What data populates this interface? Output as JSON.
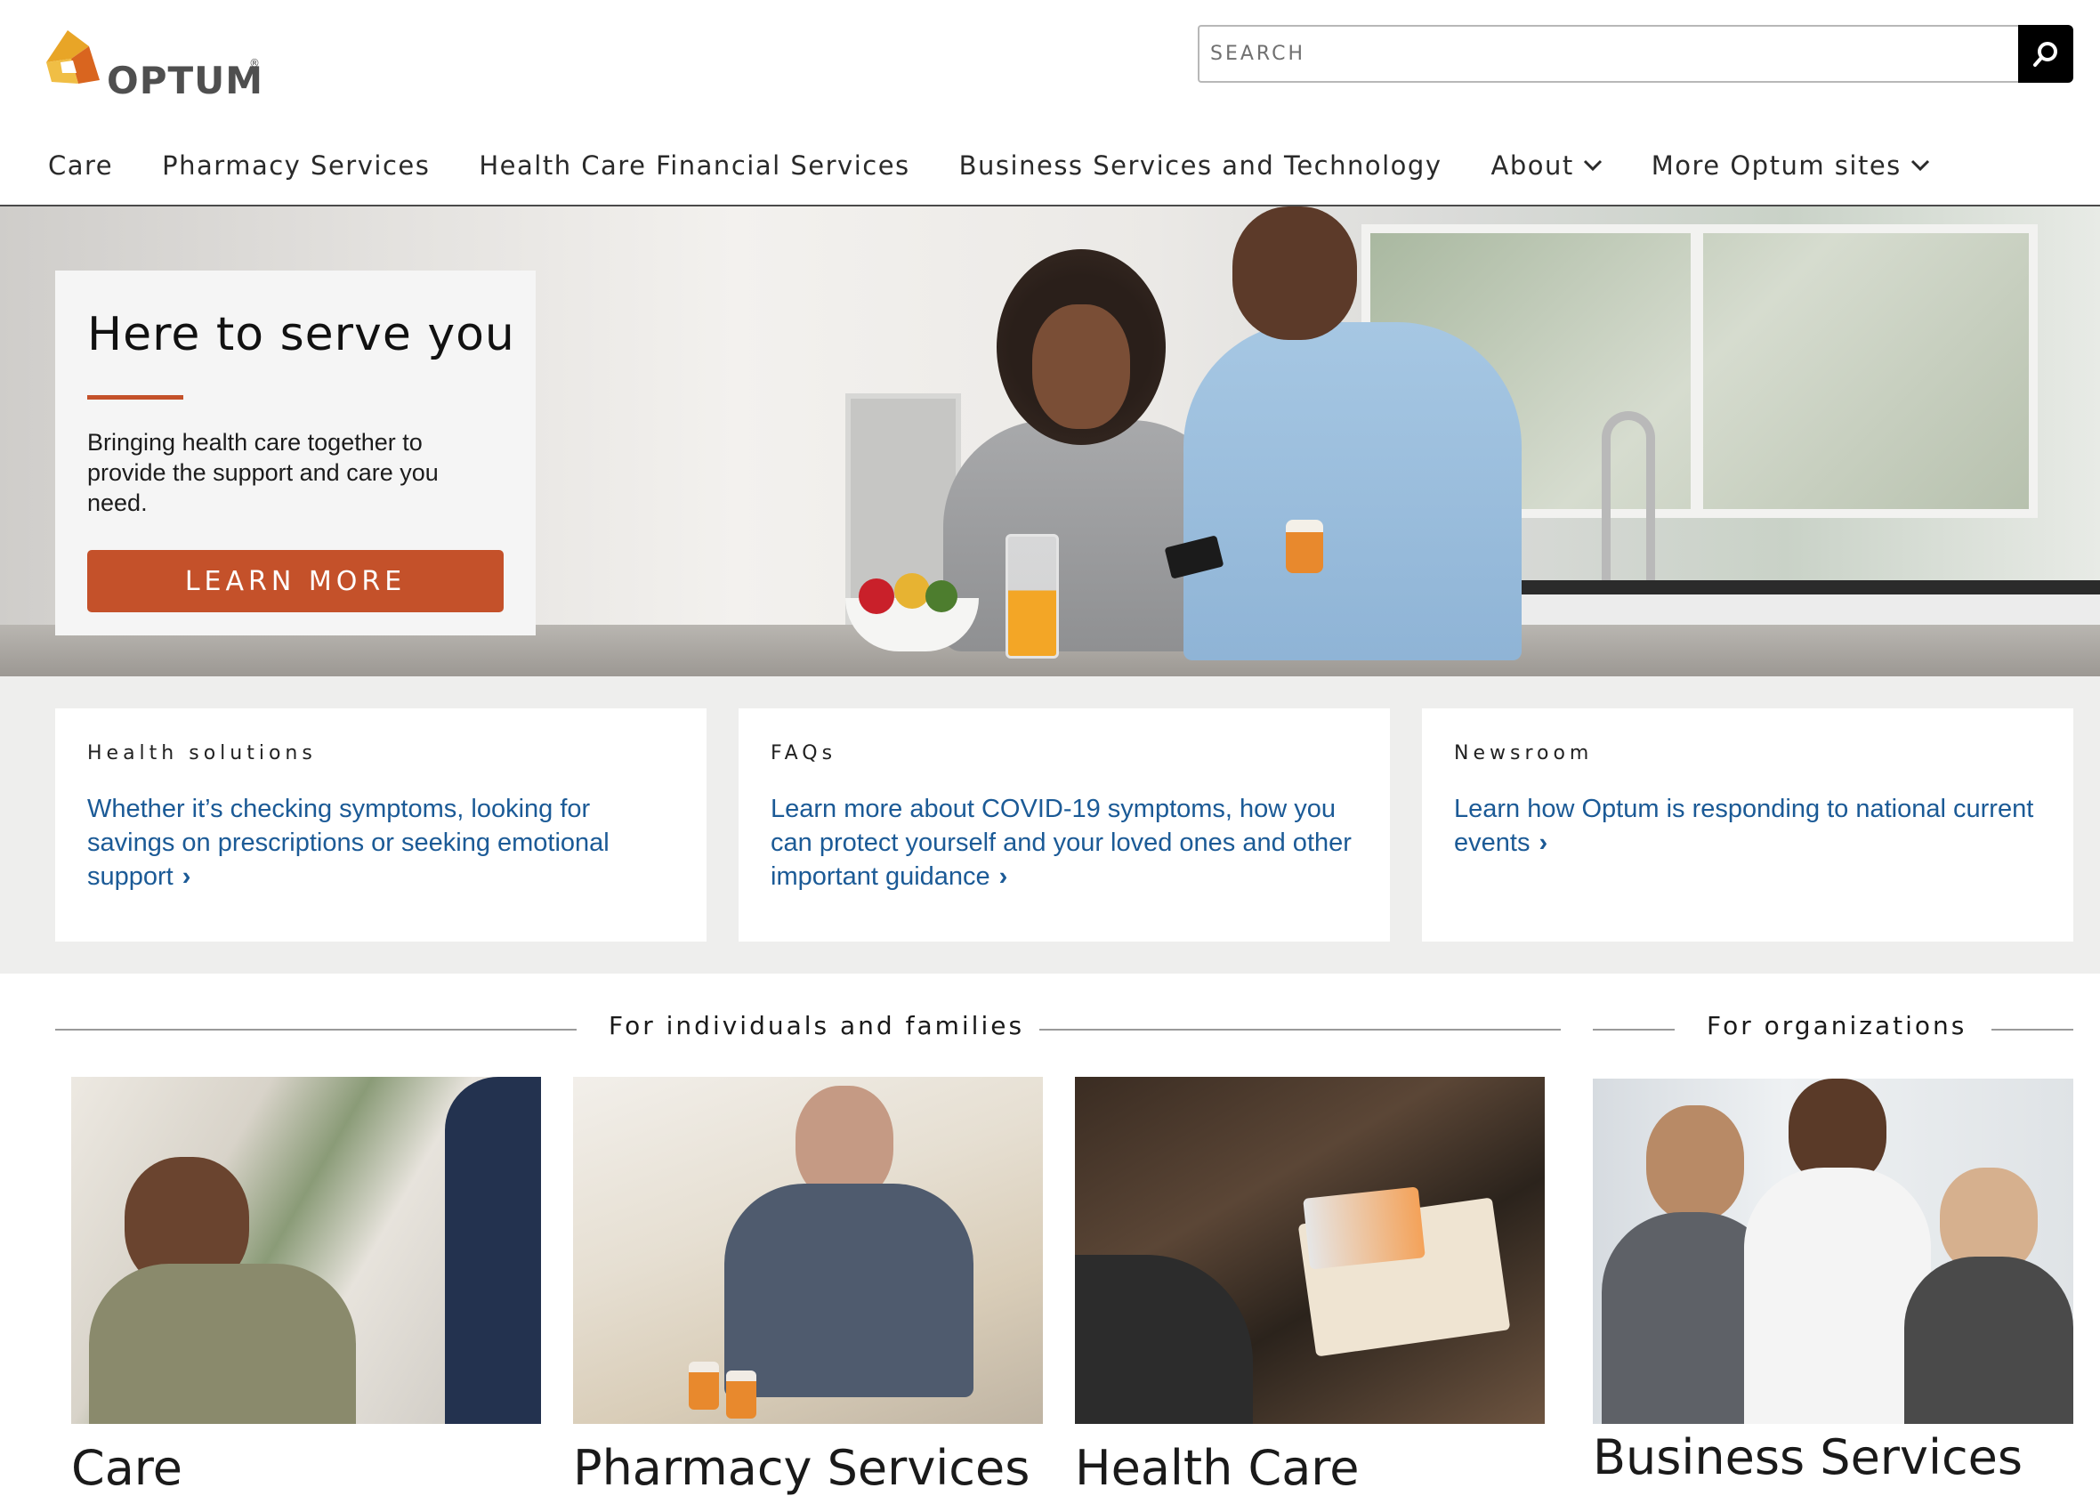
{
  "brand": {
    "name": "OPTUM",
    "registered": "®",
    "colors": {
      "orange": "#c4512a",
      "link": "#1b5a96",
      "logo_gold": "#e8a527",
      "logo_orange": "#d9651f"
    }
  },
  "search": {
    "placeholder": "SEARCH",
    "icon": "search-icon"
  },
  "nav": {
    "items": [
      {
        "label": "Care"
      },
      {
        "label": "Pharmacy Services"
      },
      {
        "label": "Health Care Financial Services"
      },
      {
        "label": "Business Services and Technology"
      },
      {
        "label": "About",
        "dropdown": true
      },
      {
        "label": "More Optum sites",
        "dropdown": true
      }
    ]
  },
  "hero": {
    "title": "Here to serve you",
    "subtitle": "Bringing health care together to provide the support and care you need.",
    "button": "LEARN MORE"
  },
  "info_cards": [
    {
      "eyebrow": "Health solutions",
      "link": "Whether it’s checking symptoms, looking for savings on prescriptions or seeking emotional support",
      "arrow": "›"
    },
    {
      "eyebrow": "FAQs",
      "link": "Learn more about COVID-19 symptoms, how you can protect yourself and your loved ones and other important guidance",
      "arrow": "›"
    },
    {
      "eyebrow": "Newsroom",
      "link": "Learn how Optum is responding to national current events",
      "arrow": "›"
    }
  ],
  "sections": {
    "individuals": "For individuals and families",
    "organizations": "For organizations"
  },
  "tiles": [
    {
      "title": "Care"
    },
    {
      "title": "Pharmacy Services"
    },
    {
      "title": "Health Care"
    },
    {
      "title": "Business Services"
    }
  ]
}
